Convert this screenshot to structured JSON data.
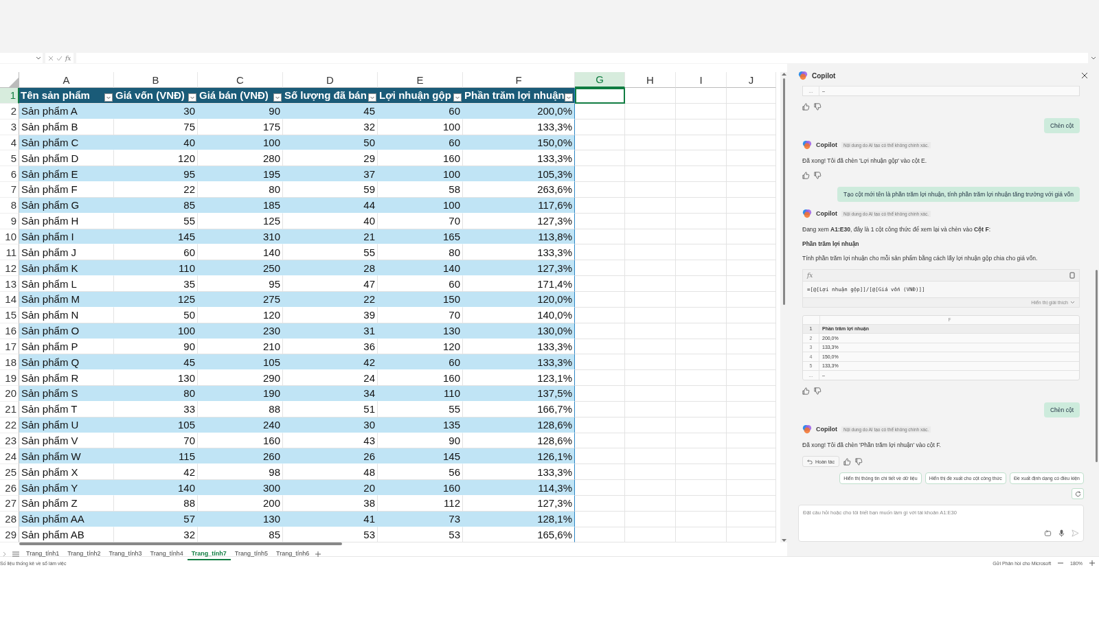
{
  "formula_bar": {
    "fx": "fx"
  },
  "sheet": {
    "columns": [
      {
        "label": "A",
        "selected": false
      },
      {
        "label": "B",
        "selected": false
      },
      {
        "label": "C",
        "selected": false
      },
      {
        "label": "D",
        "selected": false
      },
      {
        "label": "E",
        "selected": false
      },
      {
        "label": "F",
        "selected": false
      },
      {
        "label": "G",
        "selected": true
      },
      {
        "label": "H",
        "selected": false
      },
      {
        "label": "I",
        "selected": false
      },
      {
        "label": "J",
        "selected": false
      }
    ],
    "rows": [
      {
        "number": "1",
        "kind": "header",
        "selected": true,
        "cells": [
          "Tên sản phẩm",
          "Giá vốn (VNĐ)",
          "Giá bán (VNĐ)",
          "Số lượng đã bán",
          "Lợi nhuận gộp",
          "Phần trăm lợi nhuận"
        ]
      },
      {
        "number": "2",
        "kind": "data",
        "selected": false,
        "cells": [
          "Sản phẩm A",
          "30",
          "90",
          "45",
          "60",
          "200,0%"
        ]
      },
      {
        "number": "3",
        "kind": "data",
        "selected": false,
        "cells": [
          "Sản phẩm B",
          "75",
          "175",
          "32",
          "100",
          "133,3%"
        ]
      },
      {
        "number": "4",
        "kind": "data",
        "selected": false,
        "cells": [
          "Sản phẩm C",
          "40",
          "100",
          "50",
          "60",
          "150,0%"
        ]
      },
      {
        "number": "5",
        "kind": "data",
        "selected": false,
        "cells": [
          "Sản phẩm D",
          "120",
          "280",
          "29",
          "160",
          "133,3%"
        ]
      },
      {
        "number": "6",
        "kind": "data",
        "selected": false,
        "cells": [
          "Sản phẩm E",
          "95",
          "195",
          "37",
          "100",
          "105,3%"
        ]
      },
      {
        "number": "7",
        "kind": "data",
        "selected": false,
        "cells": [
          "Sản phẩm F",
          "22",
          "80",
          "59",
          "58",
          "263,6%"
        ]
      },
      {
        "number": "8",
        "kind": "data",
        "selected": false,
        "cells": [
          "Sản phẩm G",
          "85",
          "185",
          "44",
          "100",
          "117,6%"
        ]
      },
      {
        "number": "9",
        "kind": "data",
        "selected": false,
        "cells": [
          "Sản phẩm H",
          "55",
          "125",
          "40",
          "70",
          "127,3%"
        ]
      },
      {
        "number": "10",
        "kind": "data",
        "selected": false,
        "cells": [
          "Sản phẩm I",
          "145",
          "310",
          "21",
          "165",
          "113,8%"
        ]
      },
      {
        "number": "11",
        "kind": "data",
        "selected": false,
        "cells": [
          "Sản phẩm J",
          "60",
          "140",
          "55",
          "80",
          "133,3%"
        ]
      },
      {
        "number": "12",
        "kind": "data",
        "selected": false,
        "cells": [
          "Sản phẩm K",
          "110",
          "250",
          "28",
          "140",
          "127,3%"
        ]
      },
      {
        "number": "13",
        "kind": "data",
        "selected": false,
        "cells": [
          "Sản phẩm L",
          "35",
          "95",
          "47",
          "60",
          "171,4%"
        ]
      },
      {
        "number": "14",
        "kind": "data",
        "selected": false,
        "cells": [
          "Sản phẩm M",
          "125",
          "275",
          "22",
          "150",
          "120,0%"
        ]
      },
      {
        "number": "15",
        "kind": "data",
        "selected": false,
        "cells": [
          "Sản phẩm N",
          "50",
          "120",
          "39",
          "70",
          "140,0%"
        ]
      },
      {
        "number": "16",
        "kind": "data",
        "selected": false,
        "cells": [
          "Sản phẩm O",
          "100",
          "230",
          "31",
          "130",
          "130,0%"
        ]
      },
      {
        "number": "17",
        "kind": "data",
        "selected": false,
        "cells": [
          "Sản phẩm P",
          "90",
          "210",
          "36",
          "120",
          "133,3%"
        ]
      },
      {
        "number": "18",
        "kind": "data",
        "selected": false,
        "cells": [
          "Sản phẩm Q",
          "45",
          "105",
          "42",
          "60",
          "133,3%"
        ]
      },
      {
        "number": "19",
        "kind": "data",
        "selected": false,
        "cells": [
          "Sản phẩm R",
          "130",
          "290",
          "24",
          "160",
          "123,1%"
        ]
      },
      {
        "number": "20",
        "kind": "data",
        "selected": false,
        "cells": [
          "Sản phẩm S",
          "80",
          "190",
          "34",
          "110",
          "137,5%"
        ]
      },
      {
        "number": "21",
        "kind": "data",
        "selected": false,
        "cells": [
          "Sản phẩm T",
          "33",
          "88",
          "51",
          "55",
          "166,7%"
        ]
      },
      {
        "number": "22",
        "kind": "data",
        "selected": false,
        "cells": [
          "Sản phẩm U",
          "105",
          "240",
          "30",
          "135",
          "128,6%"
        ]
      },
      {
        "number": "23",
        "kind": "data",
        "selected": false,
        "cells": [
          "Sản phẩm V",
          "70",
          "160",
          "43",
          "90",
          "128,6%"
        ]
      },
      {
        "number": "24",
        "kind": "data",
        "selected": false,
        "cells": [
          "Sản phẩm W",
          "115",
          "260",
          "26",
          "145",
          "126,1%"
        ]
      },
      {
        "number": "25",
        "kind": "data",
        "selected": false,
        "cells": [
          "Sản phẩm X",
          "42",
          "98",
          "48",
          "56",
          "133,3%"
        ]
      },
      {
        "number": "26",
        "kind": "data",
        "selected": false,
        "cells": [
          "Sản phẩm Y",
          "140",
          "300",
          "20",
          "160",
          "114,3%"
        ]
      },
      {
        "number": "27",
        "kind": "data",
        "selected": false,
        "cells": [
          "Sản phẩm Z",
          "88",
          "200",
          "38",
          "112",
          "127,3%"
        ]
      },
      {
        "number": "28",
        "kind": "data",
        "selected": false,
        "cells": [
          "Sản phẩm AA",
          "57",
          "130",
          "41",
          "73",
          "128,1%"
        ]
      },
      {
        "number": "29",
        "kind": "data",
        "selected": false,
        "cells": [
          "Sản phẩm AB",
          "32",
          "85",
          "53",
          "53",
          "165,6%"
        ]
      }
    ]
  },
  "sheet_tabs": [
    {
      "label": "Trang_tính1",
      "selected": false
    },
    {
      "label": "Trang_tính2",
      "selected": false
    },
    {
      "label": "Trang_tính3",
      "selected": false
    },
    {
      "label": "Trang_tính4",
      "selected": false
    },
    {
      "label": "Trang_tính7",
      "selected": true
    },
    {
      "label": "Trang_tính5",
      "selected": false
    },
    {
      "label": "Trang_tính6",
      "selected": false
    }
  ],
  "copilot": {
    "title": "Copilot",
    "messages": [
      {
        "kind": "table_tail",
        "rows": [
          {
            "row": "…",
            "value": "–"
          }
        ]
      },
      {
        "kind": "user",
        "text": "Chèn cột"
      },
      {
        "kind": "assistant",
        "name": "Copilot",
        "disclaimer": "Nội dung do AI tạo có thể không chính xác.",
        "text": "Đã xong! Tôi đã chèn 'Lợi nhuận gộp' vào cột E."
      },
      {
        "kind": "user",
        "text": "Tạo cột mới tên là phần trăm lợi nhuận, tính phần trăm lợi nhuận tăng trưởng với giá vốn"
      },
      {
        "kind": "formula",
        "name": "Copilot",
        "disclaimer": "Nội dung do AI tạo có thể không chính xác.",
        "text": "Đang xem **A1:E30**, đây là 1 cột công thức để xem lại và chèn vào **Cột F**:",
        "heading": "Phần trăm lợi nhuận",
        "description": "Tính phần trăm lợi nhuận cho mỗi sản phẩm bằng cách lấy lợi nhuận gộp chia cho giá vốn.",
        "fx": "fx",
        "formula": "=[@[Lợi nhuận gộp]]/[@[Giá vốn (VNĐ)]]",
        "explain": "Hiển thị giải thích",
        "preview_column": "F",
        "rows": [
          {
            "row": "1",
            "value": "Phần trăm lợi nhuận"
          },
          {
            "row": "2",
            "value": "200,0%"
          },
          {
            "row": "3",
            "value": "133,3%"
          },
          {
            "row": "4",
            "value": "150,0%"
          },
          {
            "row": "5",
            "value": "133,3%"
          },
          {
            "row": "…",
            "value": "–"
          }
        ]
      },
      {
        "kind": "user",
        "text": "Chèn cột"
      },
      {
        "kind": "assistant",
        "name": "Copilot",
        "disclaimer": "Nội dung do AI tạo có thể không chính xác.",
        "text": "Đã xong! Tôi đã chèn 'Phần trăm lợi nhuận' vào cột F.",
        "undo": "Hoàn tác"
      }
    ],
    "suggestions": [
      "Hiển thị thông tin chi tiết về dữ liệu",
      "Hiển thị đề xuất cho cột công thức",
      "Đề xuất định dạng có điều kiện"
    ],
    "input": {
      "placeholder": "Đặt câu hỏi hoặc cho tôi biết bạn muốn làm gì với tài khoản A1:E30"
    }
  },
  "status_bar": {
    "left": "Số liệu thống kê về sổ làm việc",
    "feedback": "Gửi Phản hồi cho Microsoft",
    "zoom": "180%"
  }
}
